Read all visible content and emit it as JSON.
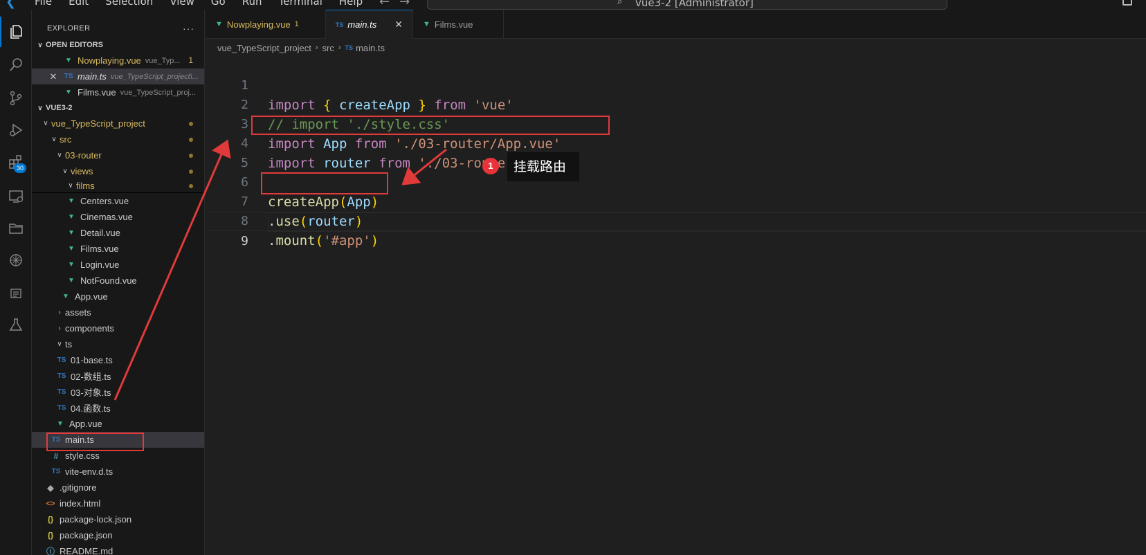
{
  "titlebar": {
    "menu": [
      "File",
      "Edit",
      "Selection",
      "View",
      "Go",
      "Run",
      "Terminal",
      "Help"
    ],
    "command_center": "vue3-2 [Administrator]"
  },
  "activity_bar": {
    "extensions_badge": "30"
  },
  "sidebar": {
    "title": "EXPLORER",
    "more": "···",
    "open_editors": {
      "heading": "OPEN EDITORS",
      "items": [
        {
          "name": "Nowplaying.vue",
          "desc": "vue_Typ...",
          "count": "1",
          "icon": "vue"
        },
        {
          "name": "main.ts",
          "desc": "vue_TypeScript_project\\...",
          "icon": "ts",
          "close": "✕"
        },
        {
          "name": "Films.vue",
          "desc": "vue_TypeScript_proj...",
          "icon": "vue"
        }
      ]
    },
    "workspace": {
      "heading": "VUE3-2",
      "tree": [
        {
          "label": "vue_TypeScript_project"
        },
        {
          "label": "src"
        },
        {
          "label": "03-router"
        },
        {
          "label": "views"
        },
        {
          "label": "films"
        },
        {
          "label": "Centers.vue"
        },
        {
          "label": "Cinemas.vue"
        },
        {
          "label": "Detail.vue"
        },
        {
          "label": "Films.vue"
        },
        {
          "label": "Login.vue"
        },
        {
          "label": "NotFound.vue"
        },
        {
          "label": "App.vue"
        },
        {
          "label": "assets"
        },
        {
          "label": "components"
        },
        {
          "label": "ts"
        },
        {
          "label": "01-base.ts"
        },
        {
          "label": "02-数组.ts"
        },
        {
          "label": "03-对象.ts"
        },
        {
          "label": "04.函数.ts"
        },
        {
          "label": "App.vue"
        },
        {
          "label": "main.ts"
        },
        {
          "label": "style.css"
        },
        {
          "label": "vite-env.d.ts"
        },
        {
          "label": ".gitignore"
        },
        {
          "label": "index.html"
        },
        {
          "label": "package-lock.json"
        },
        {
          "label": "package.json"
        },
        {
          "label": "README.md"
        }
      ]
    }
  },
  "tabs": [
    {
      "label": "Nowplaying.vue",
      "count": "1"
    },
    {
      "label": "main.ts",
      "close": "✕"
    },
    {
      "label": "Films.vue"
    }
  ],
  "breadcrumb": [
    "vue_TypeScript_project",
    "src",
    "main.ts"
  ],
  "code": {
    "line_numbers": [
      "1",
      "2",
      "3",
      "4",
      "5",
      "6",
      "7",
      "8",
      "9"
    ],
    "l1": {
      "k1": "import",
      "b1": "{",
      "id": "createApp",
      "b2": "}",
      "k2": "from",
      "s": "'vue'"
    },
    "l2": {
      "c": "// import './style.css'"
    },
    "l3": {
      "k1": "import",
      "id": "App",
      "k2": "from",
      "s": "'./03-router/App.vue'"
    },
    "l4": {
      "k1": "import",
      "id": "router",
      "k2": "from",
      "s": "'./03-router/router'"
    },
    "l6": {
      "fn": "createApp",
      "b1": "(",
      "id": "App",
      "b2": ")"
    },
    "l7": {
      "dot": ".",
      "fn": "use",
      "b1": "(",
      "id": "router",
      "b2": ")"
    },
    "l8": {
      "dot": ".",
      "fn": "mount",
      "b1": "(",
      "s": "'#app'",
      "b2": ")"
    }
  },
  "annotation": {
    "number": "1",
    "label": "挂载路由",
    "color": "#e03a3a"
  }
}
